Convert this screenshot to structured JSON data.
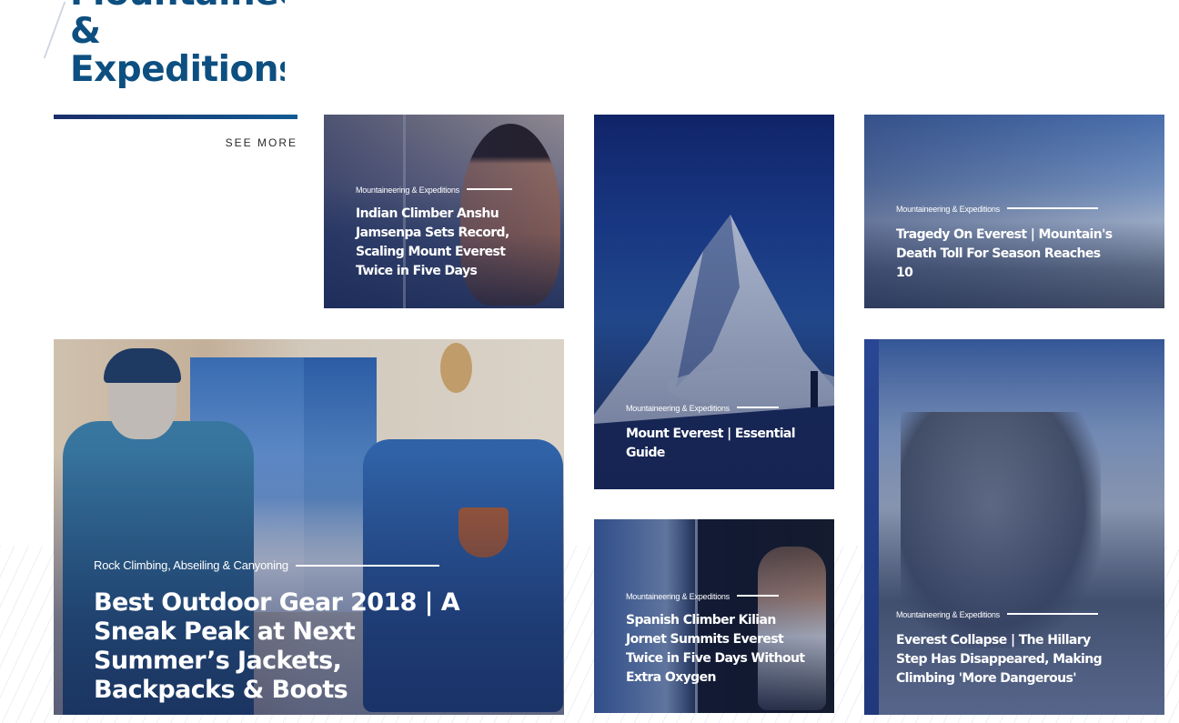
{
  "section": {
    "title_line1": "Mountaineering",
    "title_line2": "&",
    "title_line3": "Expeditions",
    "see_more": "SEE MORE"
  },
  "cards": [
    {
      "category": "Mountaineering & Expeditions",
      "headline": "Indian Climber Anshu Jamsenpa Sets Record, Scaling Mount Everest Twice in Five Days"
    },
    {
      "category": "Mountaineering & Expeditions",
      "headline": "Mount Everest | Essential Guide"
    },
    {
      "category": "Mountaineering & Expeditions",
      "headline": "Tragedy On Everest | Mountain's Death Toll For Season Reaches 10"
    },
    {
      "category": "Rock Climbing, Abseiling & Canyoning",
      "headline": "Best Outdoor Gear 2018 | A Sneak Peak at Next Summer’s Jackets, Backpacks & Boots"
    },
    {
      "category": "Mountaineering & Expeditions",
      "headline": "Spanish Climber Kilian Jornet Summits Everest Twice in Five Days Without Extra Oxygen"
    },
    {
      "category": "Mountaineering & Expeditions",
      "headline": "Everest Collapse | The Hillary Step Has Disappeared, Making Climbing 'More Dangerous'"
    }
  ],
  "colors": {
    "brand_blue": "#0d4f80",
    "overlay_navy": "#162658",
    "rule_gradient_start": "#1a2e6a",
    "rule_gradient_end": "#125a93"
  }
}
